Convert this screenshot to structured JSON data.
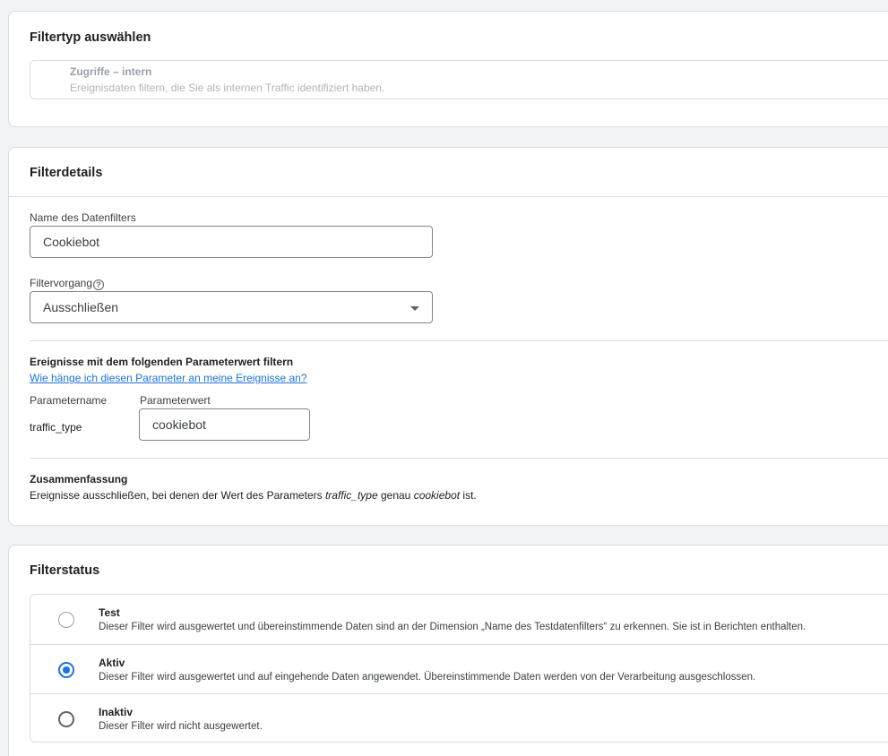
{
  "filter_type": {
    "title": "Filtertyp auswählen",
    "selected_name": "Zugriffe – intern",
    "selected_description": "Ereignisdaten filtern, die Sie als internen Traffic identifiziert haben."
  },
  "details": {
    "title": "Filterdetails",
    "name_label": "Name des Datenfilters",
    "name_value": "Cookiebot",
    "operation_label": "Filtervorgang",
    "operation_help_icon": "help-circle-icon",
    "operation_value": "Ausschließen",
    "param_section_title": "Ereignisse mit dem folgenden Parameterwert filtern",
    "param_help_link": "Wie hänge ich diesen Parameter an meine Ereignisse an?",
    "param_name_label": "Parametername",
    "param_name_value": "traffic_type",
    "param_value_label": "Parameterwert",
    "param_value": "cookiebot",
    "summary_title": "Zusammenfassung",
    "summary_prefix": "Ereignisse ausschließen, bei denen der Wert des Parameters ",
    "summary_param": "traffic_type",
    "summary_middle": " genau ",
    "summary_value": "cookiebot",
    "summary_suffix": " ist."
  },
  "status": {
    "title": "Filterstatus",
    "options": [
      {
        "label": "Test",
        "description": "Dieser Filter wird ausgewertet und übereinstimmende Daten sind an der Dimension „Name des Testdatenfilters“ zu erkennen. Sie ist in Berichten enthalten.",
        "selected": false
      },
      {
        "label": "Aktiv",
        "description": "Dieser Filter wird ausgewertet und auf eingehende Daten angewendet. Übereinstimmende Daten werden von der Verarbeitung ausgeschlossen.",
        "selected": true
      },
      {
        "label": "Inaktiv",
        "description": "Dieser Filter wird nicht ausgewertet.",
        "selected": false
      }
    ]
  },
  "colors": {
    "accent": "#1a73e8",
    "border": "#dadce0",
    "background": "#f1f3f4"
  }
}
